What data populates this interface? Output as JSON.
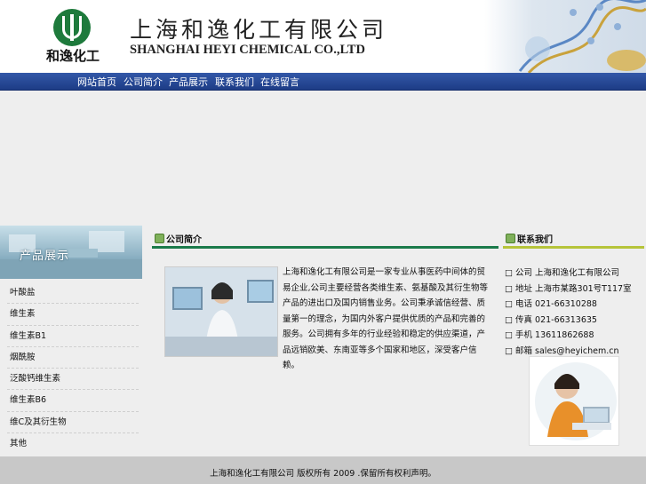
{
  "header": {
    "logo_text": "和逸化工",
    "company_cn": "上海和逸化工有限公司",
    "company_en": "SHANGHAI HEYI CHEMICAL CO.,LTD"
  },
  "nav": {
    "items": [
      {
        "label": "网站首页"
      },
      {
        "label": "公司简介"
      },
      {
        "label": "产品展示"
      },
      {
        "label": "联系我们"
      },
      {
        "label": "在线留言"
      }
    ]
  },
  "sidebar": {
    "image_label": "产品展示",
    "items": [
      {
        "label": "叶酸盐"
      },
      {
        "label": "维生素"
      },
      {
        "label": "维生素B1"
      },
      {
        "label": "烟酰胺"
      },
      {
        "label": "泛酸钙维生素"
      },
      {
        "label": "维生素B6"
      },
      {
        "label": "维C及其衍生物"
      },
      {
        "label": "其他"
      }
    ]
  },
  "about": {
    "title": "公司简介",
    "text": "上海和逸化工有限公司是一家专业从事医药中间体的贸易企业,公司主要经营各类维生素、氨基酸及其衍生物等产品的进出口及国内销售业务。公司秉承诚信经营、质量第一的理念，为国内外客户提供优质的产品和完善的服务。公司拥有多年的行业经验和稳定的供应渠道，产品远销欧美、东南亚等多个国家和地区，深受客户信赖。"
  },
  "contact": {
    "title": "联系我们",
    "rows": [
      {
        "label": "□ 公司",
        "value": "上海和逸化工有限公司"
      },
      {
        "label": "□ 地址",
        "value": "上海市某路301号T117室"
      },
      {
        "label": "□ 电话",
        "value": "021-66310288"
      },
      {
        "label": "□ 传真",
        "value": "021-66313635"
      },
      {
        "label": "□ 手机",
        "value": "13611862688"
      },
      {
        "label": "□ 邮箱",
        "value": "sales@heyichem.cn"
      }
    ]
  },
  "footer": {
    "text": "上海和逸化工有限公司 版权所有 2009 .保留所有权利声明。"
  },
  "colors": {
    "nav_bg": "#2a4b9a",
    "section_line": "#1a7a4a",
    "contact_line": "#b6c43a",
    "footer_bg": "#c8c8c8"
  }
}
